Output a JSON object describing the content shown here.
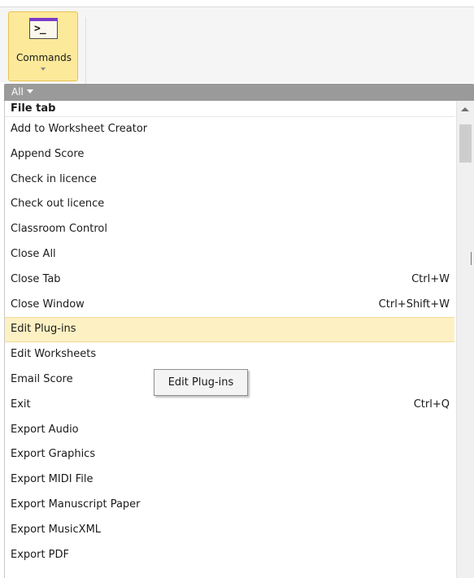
{
  "ribbon": {
    "commands_label": "Commands",
    "commands_icon": "terminal-prompt-icon",
    "commands_icon_glyph": ">_"
  },
  "filter": {
    "label": "All"
  },
  "menu": {
    "section": "File tab",
    "items": [
      {
        "label": "Add to Worksheet Creator",
        "shortcut": ""
      },
      {
        "label": "Append Score",
        "shortcut": ""
      },
      {
        "label": "Check in licence",
        "shortcut": ""
      },
      {
        "label": "Check out licence",
        "shortcut": ""
      },
      {
        "label": "Classroom Control",
        "shortcut": ""
      },
      {
        "label": "Close All",
        "shortcut": ""
      },
      {
        "label": "Close Tab",
        "shortcut": "Ctrl+W"
      },
      {
        "label": "Close Window",
        "shortcut": "Ctrl+Shift+W"
      },
      {
        "label": "Edit Plug-ins",
        "shortcut": "",
        "highlighted": true
      },
      {
        "label": "Edit Worksheets",
        "shortcut": ""
      },
      {
        "label": "Email Score",
        "shortcut": ""
      },
      {
        "label": "Exit",
        "shortcut": "Ctrl+Q"
      },
      {
        "label": "Export Audio",
        "shortcut": ""
      },
      {
        "label": "Export Graphics",
        "shortcut": ""
      },
      {
        "label": "Export MIDI File",
        "shortcut": ""
      },
      {
        "label": "Export Manuscript Paper",
        "shortcut": ""
      },
      {
        "label": "Export MusicXML",
        "shortcut": ""
      },
      {
        "label": "Export PDF",
        "shortcut": ""
      }
    ]
  },
  "tooltip": {
    "text": "Edit Plug-ins"
  },
  "colors": {
    "ribbon_button_bg": "#fde99a",
    "icon_accent": "#7b39c9",
    "filter_bar": "#9a9a9a",
    "highlight_row": "#fdf1c4"
  }
}
